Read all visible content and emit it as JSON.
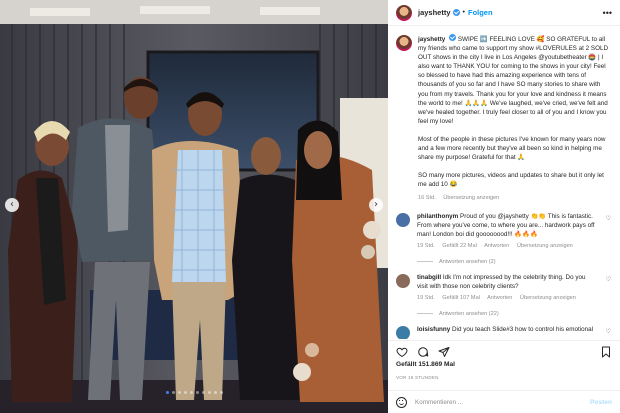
{
  "post": {
    "username": "jayshetty",
    "follow_label": "Folgen",
    "more_icon": "more-options-icon"
  },
  "caption": {
    "username": "jayshetty",
    "text1": "SWIPE ➡️ FEELING LOVE 🥰 SO GRATEFUL to all my friends who came to support my show #LOVERULES at 2 SOLD OUT shows in the city I live in Los Angeles @youtubetheater 🏟️ | I also want to THANK YOU for coming to the shows in your city! Feel so blessed to have had this amazing experience with tens of thousands of you so far and I have SO many stories to share with you from my travels. Thank you for your love and kindness it means the world to me! 🙏🙏🙏 We've laughed, we've cried, we've felt and we've healed together. I truly feel closer to all of you and I know you feel my love!",
    "text2": "Most of the people in these pictures I've known for many years now and a few more recently but they've all been so kind in helping me share my purpose! Grateful for that 🙏",
    "text3": "SO many more pictures, videos and updates to share but it only let me add 10 😂",
    "age": "16 Std.",
    "translate": "Übersetzung anzeigen"
  },
  "comments": [
    {
      "username": "philanthonym",
      "text": "Proud of you @jayshetty 👏👏 This is fantastic. From where you've come, to where you are... hardwork pays off man! London boi did goooooood!!! 🔥🔥🔥",
      "age": "19 Std.",
      "likes": "Gefällt 22 Mal",
      "reply": "Antworten",
      "translate": "Übersetzung anzeigen",
      "replies": "Antworten ansehen (2)",
      "avatar_color": "#4a6fa5"
    },
    {
      "username": "tinabgill",
      "text": "Idk I'm not impressed by the celebrity thing. Do you visit with those non celebrity clients?",
      "age": "19 Std.",
      "likes": "Gefällt 107 Mal",
      "reply": "Antworten",
      "translate": "Übersetzung anzeigen",
      "replies": "Antworten ansehen (22)",
      "avatar_color": "#8a6a5a"
    },
    {
      "username": "loisisfunny",
      "text": "Did you teach Slide#3 how to control his emotional",
      "age": "",
      "likes": "",
      "reply": "",
      "translate": "",
      "replies": "",
      "avatar_color": "#3a7ca5"
    }
  ],
  "actions": {
    "likes": "Gefällt 151.869 Mal",
    "time": "VOR 16 STUNDEN",
    "icons": [
      "heart-icon",
      "comment-icon",
      "share-icon",
      "bookmark-icon"
    ]
  },
  "add_comment": {
    "placeholder": "Kommentieren ...",
    "post_label": "Posten"
  },
  "carousel": {
    "slide_count": 10,
    "active_index": 0
  },
  "colors": {
    "link": "#0095f6",
    "verified": "#3897f0",
    "muted": "#8e8e8e",
    "text": "#262626"
  }
}
